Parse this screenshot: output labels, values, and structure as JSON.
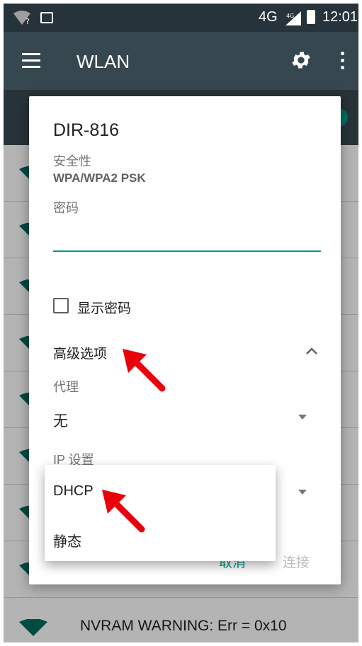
{
  "status_bar": {
    "network": "4G",
    "network_small": "4G",
    "time": "12:01"
  },
  "app_bar": {
    "title": "WLAN"
  },
  "wifi_list": {
    "last_row_text": "NVRAM WARNING: Err = 0x10"
  },
  "dialog": {
    "ssid": "DIR-816",
    "security_label": "安全性",
    "security_value": "WPA/WPA2 PSK",
    "password_label": "密码",
    "password_value": "",
    "show_password_label": "显示密码",
    "show_password_checked": false,
    "advanced_options_label": "高级选项",
    "proxy_label": "代理",
    "proxy_value": "无",
    "ip_settings_label": "IP 设置",
    "cancel_label": "取消",
    "connect_label": "连接"
  },
  "ip_dropdown": {
    "options": [
      "DHCP",
      "静态"
    ]
  },
  "colors": {
    "accent": "#009688",
    "app_bar": "#37474f",
    "status_bar": "#26333a",
    "annotation_arrow": "#e8000b"
  },
  "icons": [
    "wifi-icon",
    "image-icon",
    "signal-icon",
    "battery-icon",
    "menu-icon",
    "gear-icon",
    "more-icon",
    "chevron-up-icon",
    "dropdown-arrow-icon"
  ]
}
